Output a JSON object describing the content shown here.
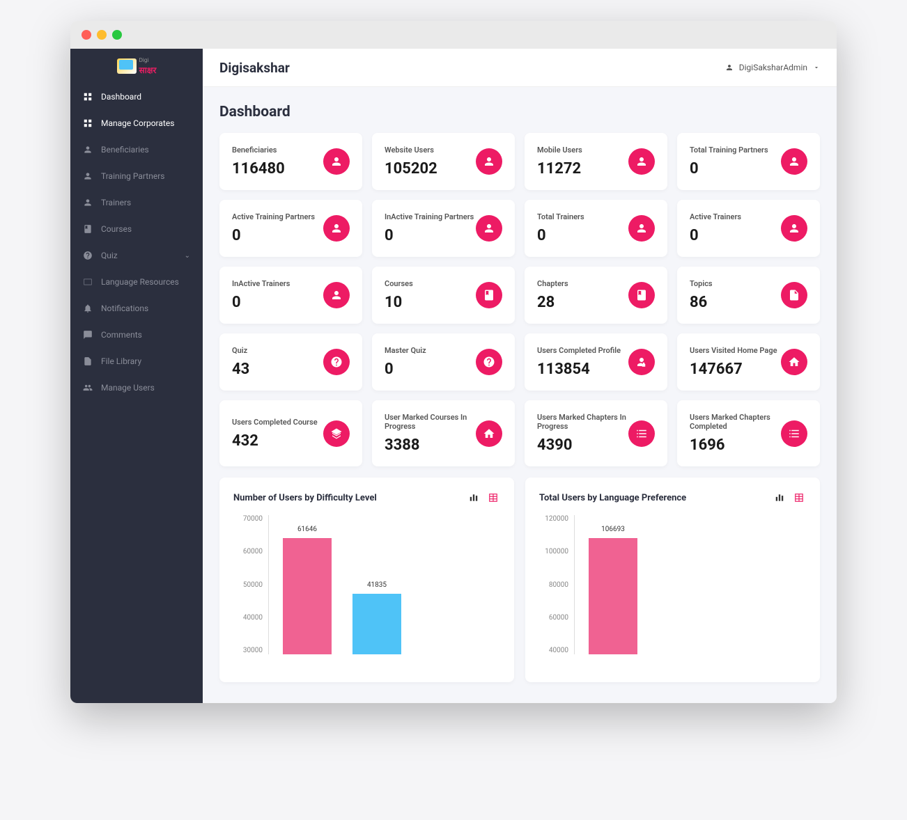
{
  "app_title": "Digisakshar",
  "user_name": "DigiSaksharAdmin",
  "page_title": "Dashboard",
  "logo": {
    "top": "Digi",
    "bottom": "साक्षर"
  },
  "sidebar": {
    "items": [
      {
        "label": "Dashboard",
        "icon": "grid",
        "active": true
      },
      {
        "label": "Manage Corporates",
        "icon": "grid",
        "active": true
      },
      {
        "label": "Beneficiaries",
        "icon": "user"
      },
      {
        "label": "Training Partners",
        "icon": "user"
      },
      {
        "label": "Trainers",
        "icon": "user"
      },
      {
        "label": "Courses",
        "icon": "book"
      },
      {
        "label": "Quiz",
        "icon": "question",
        "expandable": true
      },
      {
        "label": "Language Resources",
        "icon": "lang"
      },
      {
        "label": "Notifications",
        "icon": "bell"
      },
      {
        "label": "Comments",
        "icon": "comment"
      },
      {
        "label": "File Library",
        "icon": "file"
      },
      {
        "label": "Manage Users",
        "icon": "users"
      }
    ]
  },
  "stats": [
    {
      "label": "Beneficiaries",
      "value": "116480",
      "icon": "user"
    },
    {
      "label": "Website Users",
      "value": "105202",
      "icon": "user"
    },
    {
      "label": "Mobile Users",
      "value": "11272",
      "icon": "user"
    },
    {
      "label": "Total Training Partners",
      "value": "0",
      "icon": "user"
    },
    {
      "label": "Active Training Partners",
      "value": "0",
      "icon": "user"
    },
    {
      "label": "InActive Training Partners",
      "value": "0",
      "icon": "user"
    },
    {
      "label": "Total Trainers",
      "value": "0",
      "icon": "user"
    },
    {
      "label": "Active Trainers",
      "value": "0",
      "icon": "user"
    },
    {
      "label": "InActive Trainers",
      "value": "0",
      "icon": "user"
    },
    {
      "label": "Courses",
      "value": "10",
      "icon": "book"
    },
    {
      "label": "Chapters",
      "value": "28",
      "icon": "book"
    },
    {
      "label": "Topics",
      "value": "86",
      "icon": "doc"
    },
    {
      "label": "Quiz",
      "value": "43",
      "icon": "question"
    },
    {
      "label": "Master Quiz",
      "value": "0",
      "icon": "question"
    },
    {
      "label": "Users Completed Profile",
      "value": "113854",
      "icon": "userlock"
    },
    {
      "label": "Users Visited Home Page",
      "value": "147667",
      "icon": "home"
    },
    {
      "label": "Users Completed Course",
      "value": "432",
      "icon": "stack"
    },
    {
      "label": "User Marked Courses In Progress",
      "value": "3388",
      "icon": "home"
    },
    {
      "label": "Users Marked Chapters In Progress",
      "value": "4390",
      "icon": "list"
    },
    {
      "label": "Users Marked Chapters Completed",
      "value": "1696",
      "icon": "list"
    }
  ],
  "chart_data": [
    {
      "type": "bar",
      "title": "Number of Users by Difficulty Level",
      "categories": [
        "",
        ""
      ],
      "values": [
        61646,
        41835
      ],
      "colors": [
        "#f06292",
        "#4fc3f7"
      ],
      "ylim": [
        20000,
        70000
      ],
      "yticks": [
        70000,
        60000,
        50000,
        40000,
        30000
      ]
    },
    {
      "type": "bar",
      "title": "Total Users by Language Preference",
      "categories": [
        ""
      ],
      "values": [
        106693
      ],
      "colors": [
        "#f06292"
      ],
      "ylim": [
        40000,
        120000
      ],
      "yticks": [
        120000,
        100000,
        80000,
        60000,
        40000
      ]
    }
  ]
}
